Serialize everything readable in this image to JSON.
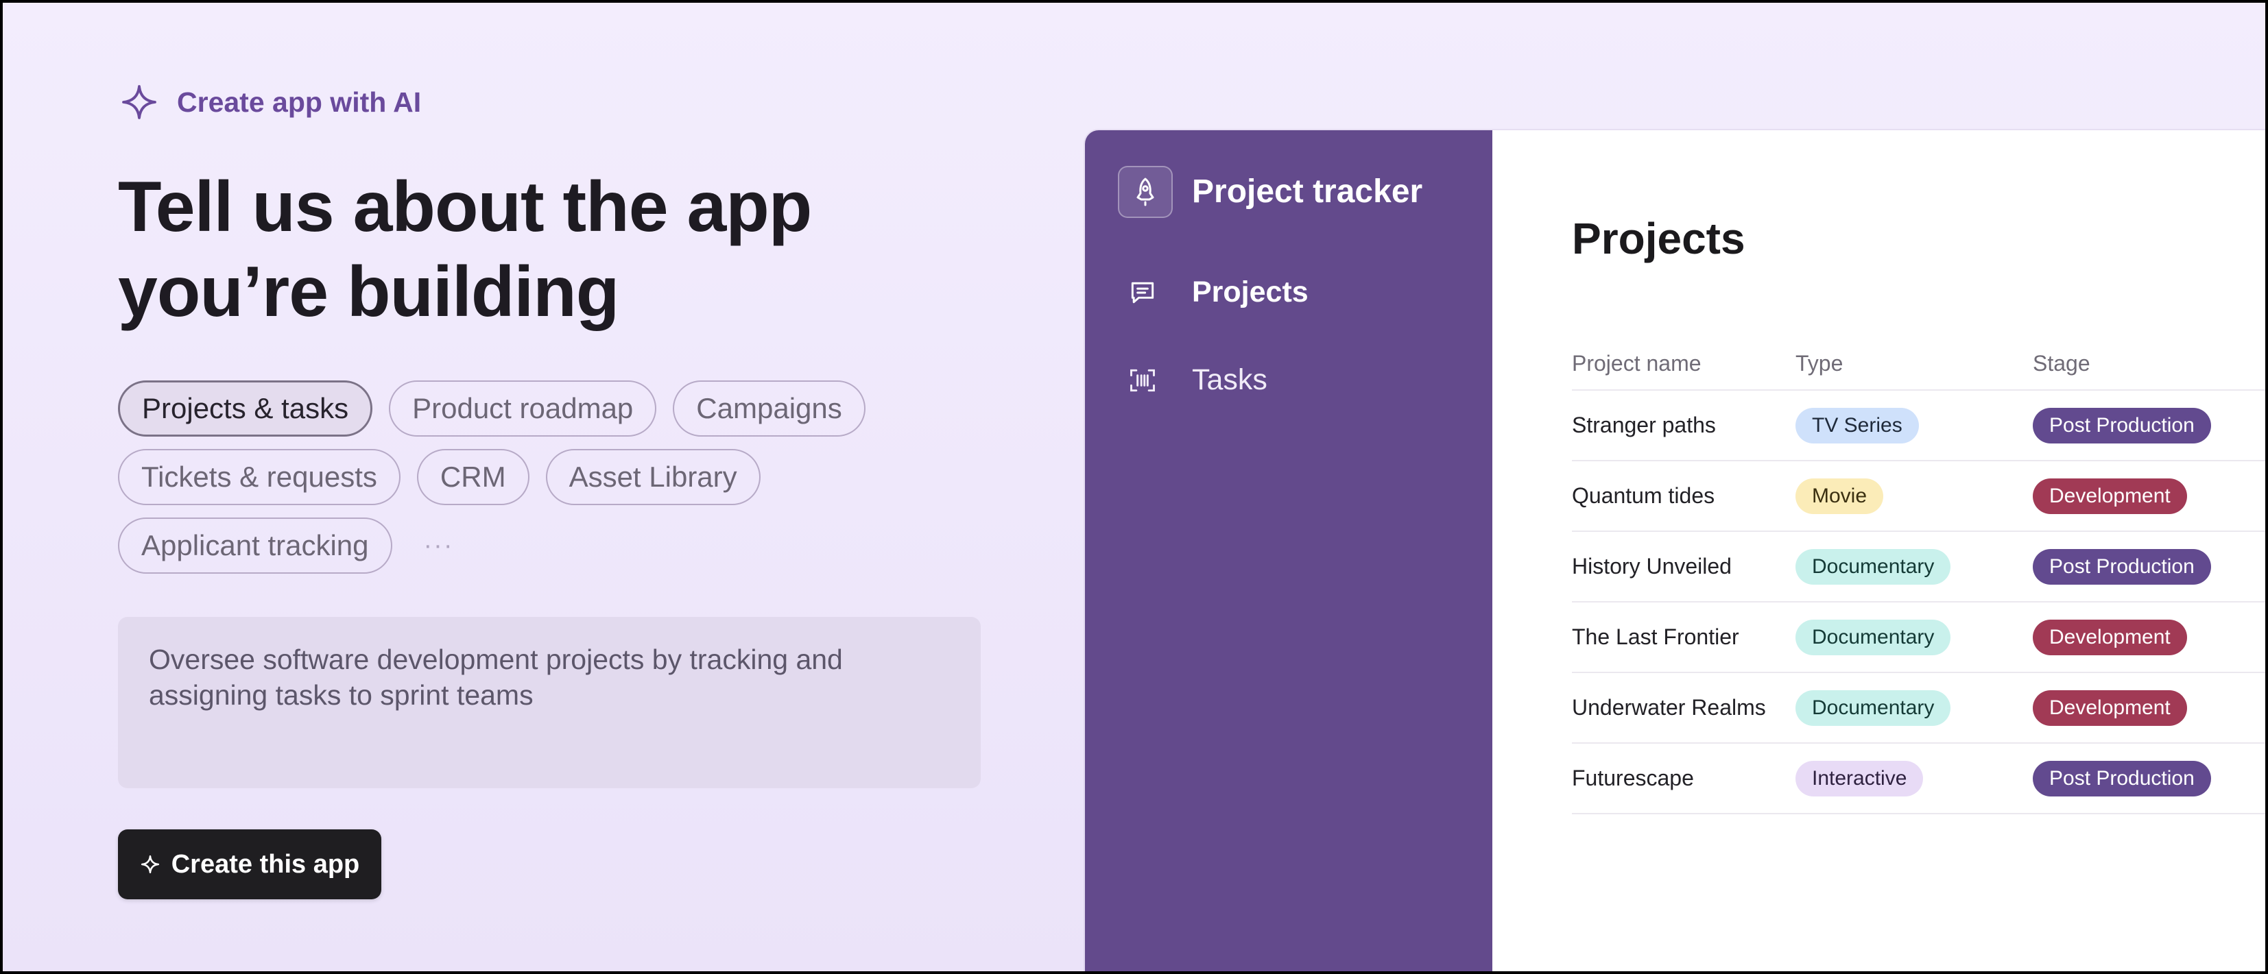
{
  "eyebrow": {
    "icon": "sparkle-icon",
    "label": "Create app with AI",
    "color": "#6a4a9c"
  },
  "headline": {
    "line1": "Tell us about the app",
    "line2": "you’re building"
  },
  "templates": {
    "rows": [
      [
        {
          "label": "Projects & tasks",
          "selected": true
        },
        {
          "label": "Product roadmap",
          "selected": false
        },
        {
          "label": "Campaigns",
          "selected": false
        }
      ],
      [
        {
          "label": "Tickets & requests",
          "selected": false
        },
        {
          "label": "CRM",
          "selected": false
        },
        {
          "label": "Asset Library",
          "selected": false
        }
      ],
      [
        {
          "label": "Applicant tracking",
          "selected": false
        }
      ]
    ],
    "more_label": "···"
  },
  "prompt": {
    "text": "Oversee software development projects by tracking and assigning tasks to sprint teams"
  },
  "create_button": {
    "icon": "sparkle-icon",
    "label": "Create this app"
  },
  "preview": {
    "app_title": "Project tracker",
    "app_icon": "rocket-icon",
    "sidebar_color": "#634a8c",
    "nav": [
      {
        "label": "Projects",
        "icon": "message-square-icon",
        "active": true
      },
      {
        "label": "Tasks",
        "icon": "barcode-scan-icon",
        "active": false
      }
    ],
    "main_title": "Projects",
    "table": {
      "headers": [
        "Project name",
        "Type",
        "Stage"
      ],
      "rows": [
        {
          "name": "Stranger paths",
          "type": "TV Series",
          "stage": "Post Production"
        },
        {
          "name": "Quantum tides",
          "type": "Movie",
          "stage": "Development"
        },
        {
          "name": "History Unveiled",
          "type": "Documentary",
          "stage": "Post Production"
        },
        {
          "name": "The Last Frontier",
          "type": "Documentary",
          "stage": "Development"
        },
        {
          "name": "Underwater Realms",
          "type": "Documentary",
          "stage": "Development"
        },
        {
          "name": "Futurescape",
          "type": "Interactive",
          "stage": "Post Production"
        }
      ]
    },
    "type_colors": {
      "TV Series": {
        "bg": "#cfe1fb",
        "fg": "#1f2a3a"
      },
      "Movie": {
        "bg": "#fbecb8",
        "fg": "#3a2f10"
      },
      "Documentary": {
        "bg": "#c9f1ec",
        "fg": "#143a36"
      },
      "Interactive": {
        "bg": "#e8dbf6",
        "fg": "#2f2240"
      }
    },
    "stage_colors": {
      "Post Production": {
        "bg": "#624a8f",
        "fg": "#ffffff"
      },
      "Development": {
        "bg": "#a13a55",
        "fg": "#ffffff"
      }
    }
  }
}
